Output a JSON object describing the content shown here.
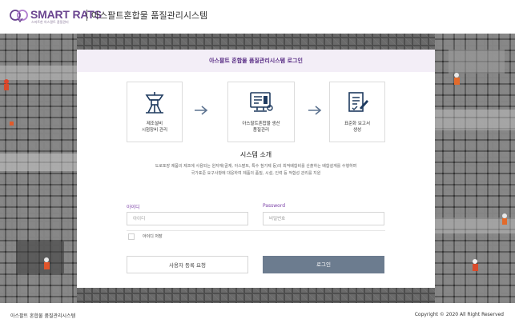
{
  "header": {
    "logo_text": "SMART RATS",
    "logo_subtitle": "스마트한 아스팔트 품질관리",
    "system_title": "아스팔트혼합물 품질관리시스템"
  },
  "card": {
    "title": "아스팔트 혼합물 품질관리시스템 로그인"
  },
  "steps": [
    {
      "icon": "plant-equipment-icon",
      "label_line1": "제조설비",
      "label_line2": "시험장비 관리"
    },
    {
      "icon": "production-monitor-icon",
      "label_line1": "아스팔트혼합물 생산",
      "label_line2": "품질관리"
    },
    {
      "icon": "report-document-icon",
      "label_line1": "표준화 보고서",
      "label_line2": "생성"
    }
  ],
  "intro": {
    "title": "시스템 소개",
    "line1": "도로포장 제품의 제조에 사용되는 원자재(골재, 아스팔트, 특수 첨가제 등)의 최적배합비를 산출하는 배합설계를 수행하며",
    "line2": "국가표준 요구사항에 대응하여 제품의 품질, 시설, 인력 등 적합성 관리를 지원"
  },
  "login": {
    "id_label": "아이디",
    "id_placeholder": "아이디",
    "id_value": "",
    "password_label": "Password",
    "password_placeholder": "비밀번호",
    "password_value": "",
    "remember_label": "아이디 저장",
    "remember_checked": false,
    "register_button": "사용자 등록 요청",
    "login_button": "로그인"
  },
  "footer": {
    "left": "아스팔트 혼합물 품질관리시스템",
    "right": "Copyright © 2020 All Right Reserved"
  },
  "colors": {
    "brand": "#6b4590",
    "accent": "#7a3fa6",
    "login_button": "#6c7c8f",
    "card_header": "#f3eef7"
  }
}
